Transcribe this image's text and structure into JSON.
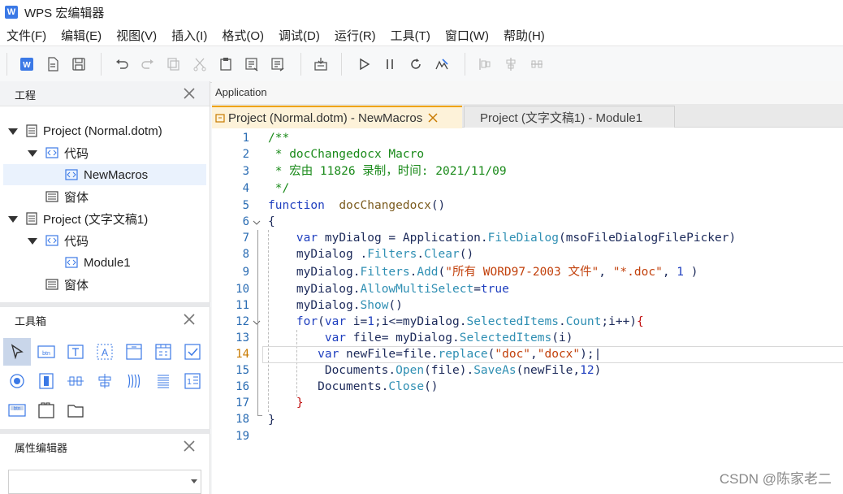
{
  "window": {
    "logo_letter": "W",
    "title": "WPS 宏编辑器"
  },
  "menu": [
    "文件(F)",
    "编辑(E)",
    "视图(V)",
    "插入(I)",
    "格式(O)",
    "调试(D)",
    "运行(R)",
    "工具(T)",
    "窗口(W)",
    "帮助(H)"
  ],
  "project_panel": {
    "title": "工程",
    "tree": [
      {
        "label": "Project (Normal.dotm)",
        "icon": "project-icon"
      },
      {
        "label": "代码",
        "icon": "code-folder-icon"
      },
      {
        "label": "NewMacros",
        "icon": "module-icon",
        "selected": true
      },
      {
        "label": "窗体",
        "icon": "form-folder-icon"
      },
      {
        "label": "Project (文字文稿1)",
        "icon": "project-icon"
      },
      {
        "label": "代码",
        "icon": "code-folder-icon"
      },
      {
        "label": "Module1",
        "icon": "module-icon"
      },
      {
        "label": "窗体",
        "icon": "form-folder-icon"
      }
    ]
  },
  "toolbox_panel": {
    "title": "工具箱",
    "tool_btn_text": "btn",
    "tool_label_text": "A",
    "tool_list_text": "1"
  },
  "property_panel": {
    "title": "属性编辑器",
    "dropdown_value": ""
  },
  "editor": {
    "app_label": "Application",
    "active_tab": "Project (Normal.dotm) - NewMacros",
    "inactive_tab": "Project (文字文稿1) - Module1",
    "current_line": 14,
    "line_numbers": [
      "1",
      "2",
      "3",
      "4",
      "5",
      "6",
      "7",
      "8",
      "9",
      "10",
      "11",
      "12",
      "13",
      "14",
      "15",
      "16",
      "17",
      "18",
      "19"
    ]
  },
  "watermark": "CSDN @陈家老二",
  "colors": {
    "accent": "#f0a300",
    "selection": "#eaf2fd",
    "line_number": "#2a6cb3"
  }
}
